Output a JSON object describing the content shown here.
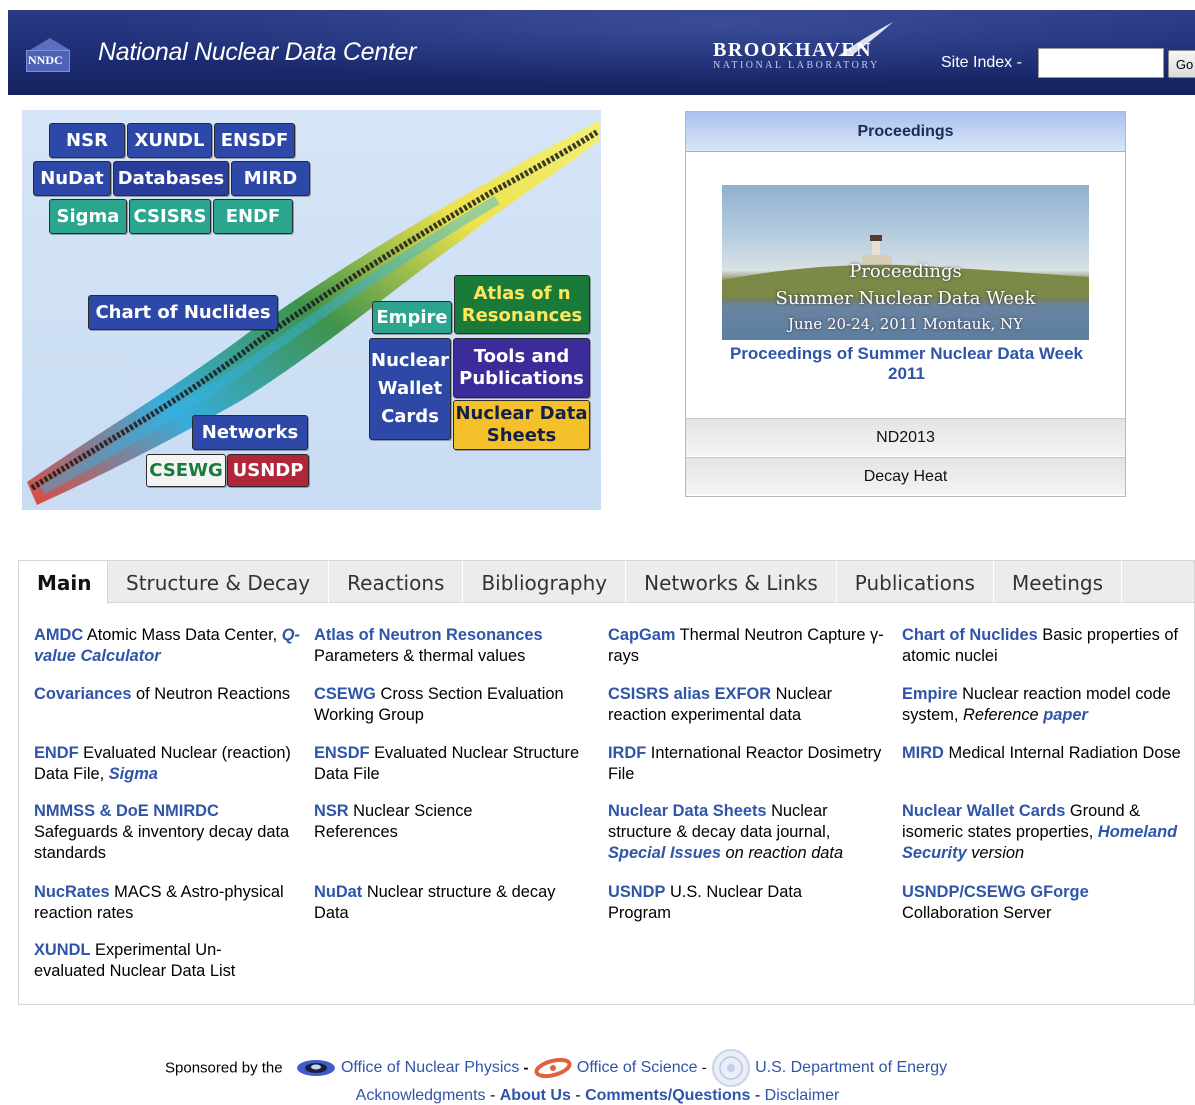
{
  "header": {
    "logo_text": "NNDC",
    "title": "National Nuclear Data Center",
    "bnl_main": "BROOKHAVEN",
    "bnl_sub": "NATIONAL LABORATORY",
    "site_index_label": "Site Index -",
    "site_index_value": "",
    "go_label": "Go"
  },
  "hero": {
    "nsr": "NSR",
    "xundl": "XUNDL",
    "ensdf": "ENSDF",
    "nudat": "NuDat",
    "databases": "Databases",
    "mird": "MIRD",
    "sigma": "Sigma",
    "csisrs": "CSISRS",
    "endf": "ENDF",
    "chart": "Chart of Nuclides",
    "empire": "Empire",
    "atlas_1": "Atlas of n",
    "atlas_2": "Resonances",
    "nwc_1": "Nuclear",
    "nwc_2": "Wallet",
    "nwc_3": "Cards",
    "tools_1": "Tools and",
    "tools_2": "Publications",
    "nds_1": "Nuclear Data",
    "nds_2": "Sheets",
    "networks": "Networks",
    "csewg": "CSEWG",
    "usndp": "USNDP"
  },
  "proceedings": {
    "heading": "Proceedings",
    "img_line1": "Proceedings",
    "img_line2": "Summer Nuclear Data Week",
    "img_line3": "June 20-24, 2011   Montauk, NY",
    "link": "Proceedings of Summer Nuclear Data Week 2011",
    "rows": [
      "ND2013",
      "Decay Heat"
    ]
  },
  "tabs": [
    "Main",
    "Structure & Decay",
    "Reactions",
    "Bibliography",
    "Networks & Links",
    "Publications",
    "Meetings"
  ],
  "entries": {
    "amdc": {
      "k": "AMDC",
      "t1": "  Atomic Mass Data Center, ",
      "ki": "Q-value Calculator"
    },
    "atlas": {
      "k": "Atlas of Neutron Resonances",
      "t1": " Parameters & thermal values"
    },
    "capgam": {
      "k": "CapGam",
      "t1": "  Thermal Neutron Capture γ-rays"
    },
    "chart": {
      "k": "Chart of Nuclides",
      "t1": "  Basic properties of atomic nuclei"
    },
    "cov": {
      "k": "Covariances",
      "t1": "  of Neutron Reactions"
    },
    "csewg": {
      "k": "CSEWG",
      "t1": "  Cross Section Evaluation Working Group"
    },
    "csisrs": {
      "k": "CSISRS alias EXFOR",
      "t1": "  Nuclear reaction experimental data"
    },
    "empire": {
      "k": "Empire",
      "t1": "  Nuclear reaction model code system, ",
      "i": "Reference",
      "ki": "paper"
    },
    "endf": {
      "k": "ENDF",
      "t1": "  Evaluated Nuclear (reaction) Data File, ",
      "ki": "Sigma"
    },
    "ensdf": {
      "k": "ENSDF",
      "t1": "  Evaluated Nuclear Structure Data File"
    },
    "irdf": {
      "k": "IRDF",
      "t1": "  International Reactor Dosimetry File"
    },
    "mird": {
      "k": "MIRD",
      "t1": "  Medical Internal Radiation Dose"
    },
    "nmmss": {
      "k": "NMMSS & DoE NMIRDC",
      "t1": "Safeguards & inventory decay data standards"
    },
    "nsr": {
      "k": "NSR",
      "t1": "  Nuclear Science References"
    },
    "nds": {
      "k": "Nuclear Data Sheets",
      "t1": "  Nuclear structure & decay data journal, ",
      "ki": "Special Issues",
      "i": " on reaction data"
    },
    "nwc": {
      "k": "Nuclear Wallet Cards",
      "t1": "  Ground & isomeric states properties, ",
      "ki": "Homeland Security",
      "i": " version"
    },
    "nucrates": {
      "k": "NucRates",
      "t1": "  MACS & Astro-physical reaction rates"
    },
    "nudat": {
      "k": "NuDat",
      "t1": "  Nuclear structure & decay Data"
    },
    "usndp": {
      "k": "USNDP",
      "t1": "  U.S. Nuclear Data Program"
    },
    "gforge": {
      "k": "USNDP/CSEWG GForge",
      "t1": "Collaboration Server"
    },
    "xundl": {
      "k": "XUNDL",
      "t1": "  Experimental Un-evaluated Nuclear Data List"
    }
  },
  "footer": {
    "sponsored": "Sponsored by the",
    "onp": "Office of Nuclear Physics",
    "dash1": " - ",
    "os": "Office of Science",
    "dash2": " - ",
    "doe": "U.S. Department of Energy",
    "ack": "Acknowledgments",
    "about": "About Us",
    "comments": "Comments/Questions",
    "disclaimer": "Disclaimer",
    "sep": " - "
  },
  "colors": {
    "header_bg": "#1f2f78",
    "link_blue": "#2f55a8",
    "panel_head": "#a9c1ec"
  }
}
